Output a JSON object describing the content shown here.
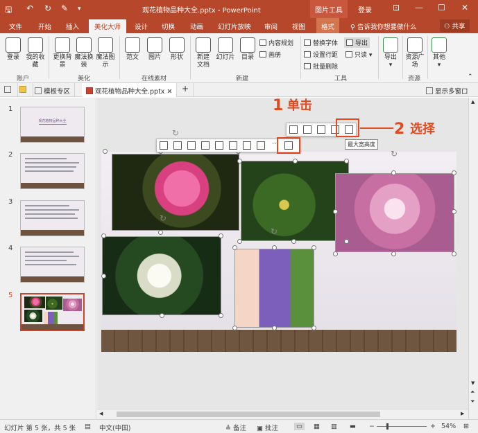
{
  "titlebar": {
    "title": "观花植物品种大全.pptx - PowerPoint",
    "context_group": "图片工具",
    "login": "登录",
    "save_icon": "save-icon",
    "undo_icon": "undo-icon",
    "redo_icon": "redo-icon",
    "format_painter_icon": "format-painter-icon",
    "customize_icon": "customize-qa-icon",
    "restore_icon": "ribbon-display-icon",
    "minimize": "—",
    "maximize": "☐",
    "close": "✕"
  },
  "tabs": {
    "items": [
      "文件",
      "开始",
      "插入",
      "美化大师",
      "设计",
      "切换",
      "动画",
      "幻灯片放映",
      "审阅",
      "视图",
      "格式"
    ],
    "active": "美化大师",
    "context": "格式",
    "tell_me": "告诉我你想要做什么",
    "share": "共享"
  },
  "ribbon": {
    "account": {
      "label": "账户",
      "buttons": [
        "登录",
        "我的收藏"
      ]
    },
    "beautify": {
      "label": "美化",
      "buttons": [
        "更换背景",
        "魔法换装",
        "魔法图示"
      ]
    },
    "online": {
      "label": "在线素材",
      "buttons": [
        "范文",
        "图片",
        "形状"
      ]
    },
    "new": {
      "label": "新建",
      "buttons": [
        "新建文档",
        "幻灯片",
        "目录"
      ],
      "small": [
        "内容规划",
        "画册"
      ]
    },
    "tools": {
      "label": "工具",
      "small": [
        "替换字体",
        "导出",
        "设置行距",
        "只读",
        "批量删除"
      ]
    },
    "export": {
      "button": "导出"
    },
    "resources": {
      "label": "资源",
      "button": "资源广场"
    },
    "other": {
      "button": "其他"
    }
  },
  "doc_tabs": {
    "template_tab": "模板专区",
    "file_tab": "观花植物品种大全.pptx",
    "add": "+",
    "show_multi": "显示多窗口"
  },
  "thumbnails": {
    "numbers": [
      "1",
      "2",
      "3",
      "4",
      "5"
    ],
    "active": "5",
    "slide1_title": "观花植物品种大全"
  },
  "annotations": {
    "step1_num": "1",
    "step1_text": "单击",
    "step2_num": "2",
    "step2_text": "选择",
    "tooltip": "最大宽高度"
  },
  "statusbar": {
    "slide_info": "幻灯片 第 5 张，共 5 张",
    "language": "中文(中国)",
    "notes": "备注",
    "comments": "批注",
    "zoom_minus": "−",
    "zoom_plus": "+",
    "zoom": "54%"
  },
  "colors": {
    "accent": "#b7472a",
    "callout": "#e2491f",
    "active_thumb": "#c9442a"
  }
}
